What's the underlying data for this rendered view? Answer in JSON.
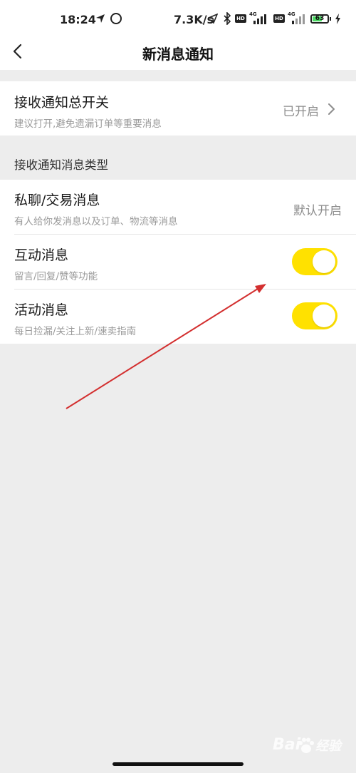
{
  "status_bar": {
    "time": "18:24",
    "speed": "7.3K/s",
    "hd_label": "HD",
    "network_label": "4G",
    "battery": "63",
    "battery_fraction": 0.63
  },
  "navbar": {
    "title": "新消息通知"
  },
  "master_switch": {
    "title": "接收通知总开关",
    "subtitle": "建议打开,避免遗漏订单等重要消息",
    "value": "已开启"
  },
  "section": {
    "label": "接收通知消息类型"
  },
  "items": [
    {
      "title": "私聊/交易消息",
      "subtitle": "有人给你发消息以及订单、物流等消息",
      "value": "默认开启"
    },
    {
      "title": "互动消息",
      "subtitle": "留言/回复/赞等功能",
      "on": true
    },
    {
      "title": "活动消息",
      "subtitle": "每日捡漏/关注上新/速卖指南",
      "on": true
    }
  ],
  "colors": {
    "toggle_on": "#ffe100",
    "background": "#ededed",
    "annotation_arrow": "#d32f2f"
  },
  "watermark": {
    "left": "Bai",
    "right": "经验"
  }
}
